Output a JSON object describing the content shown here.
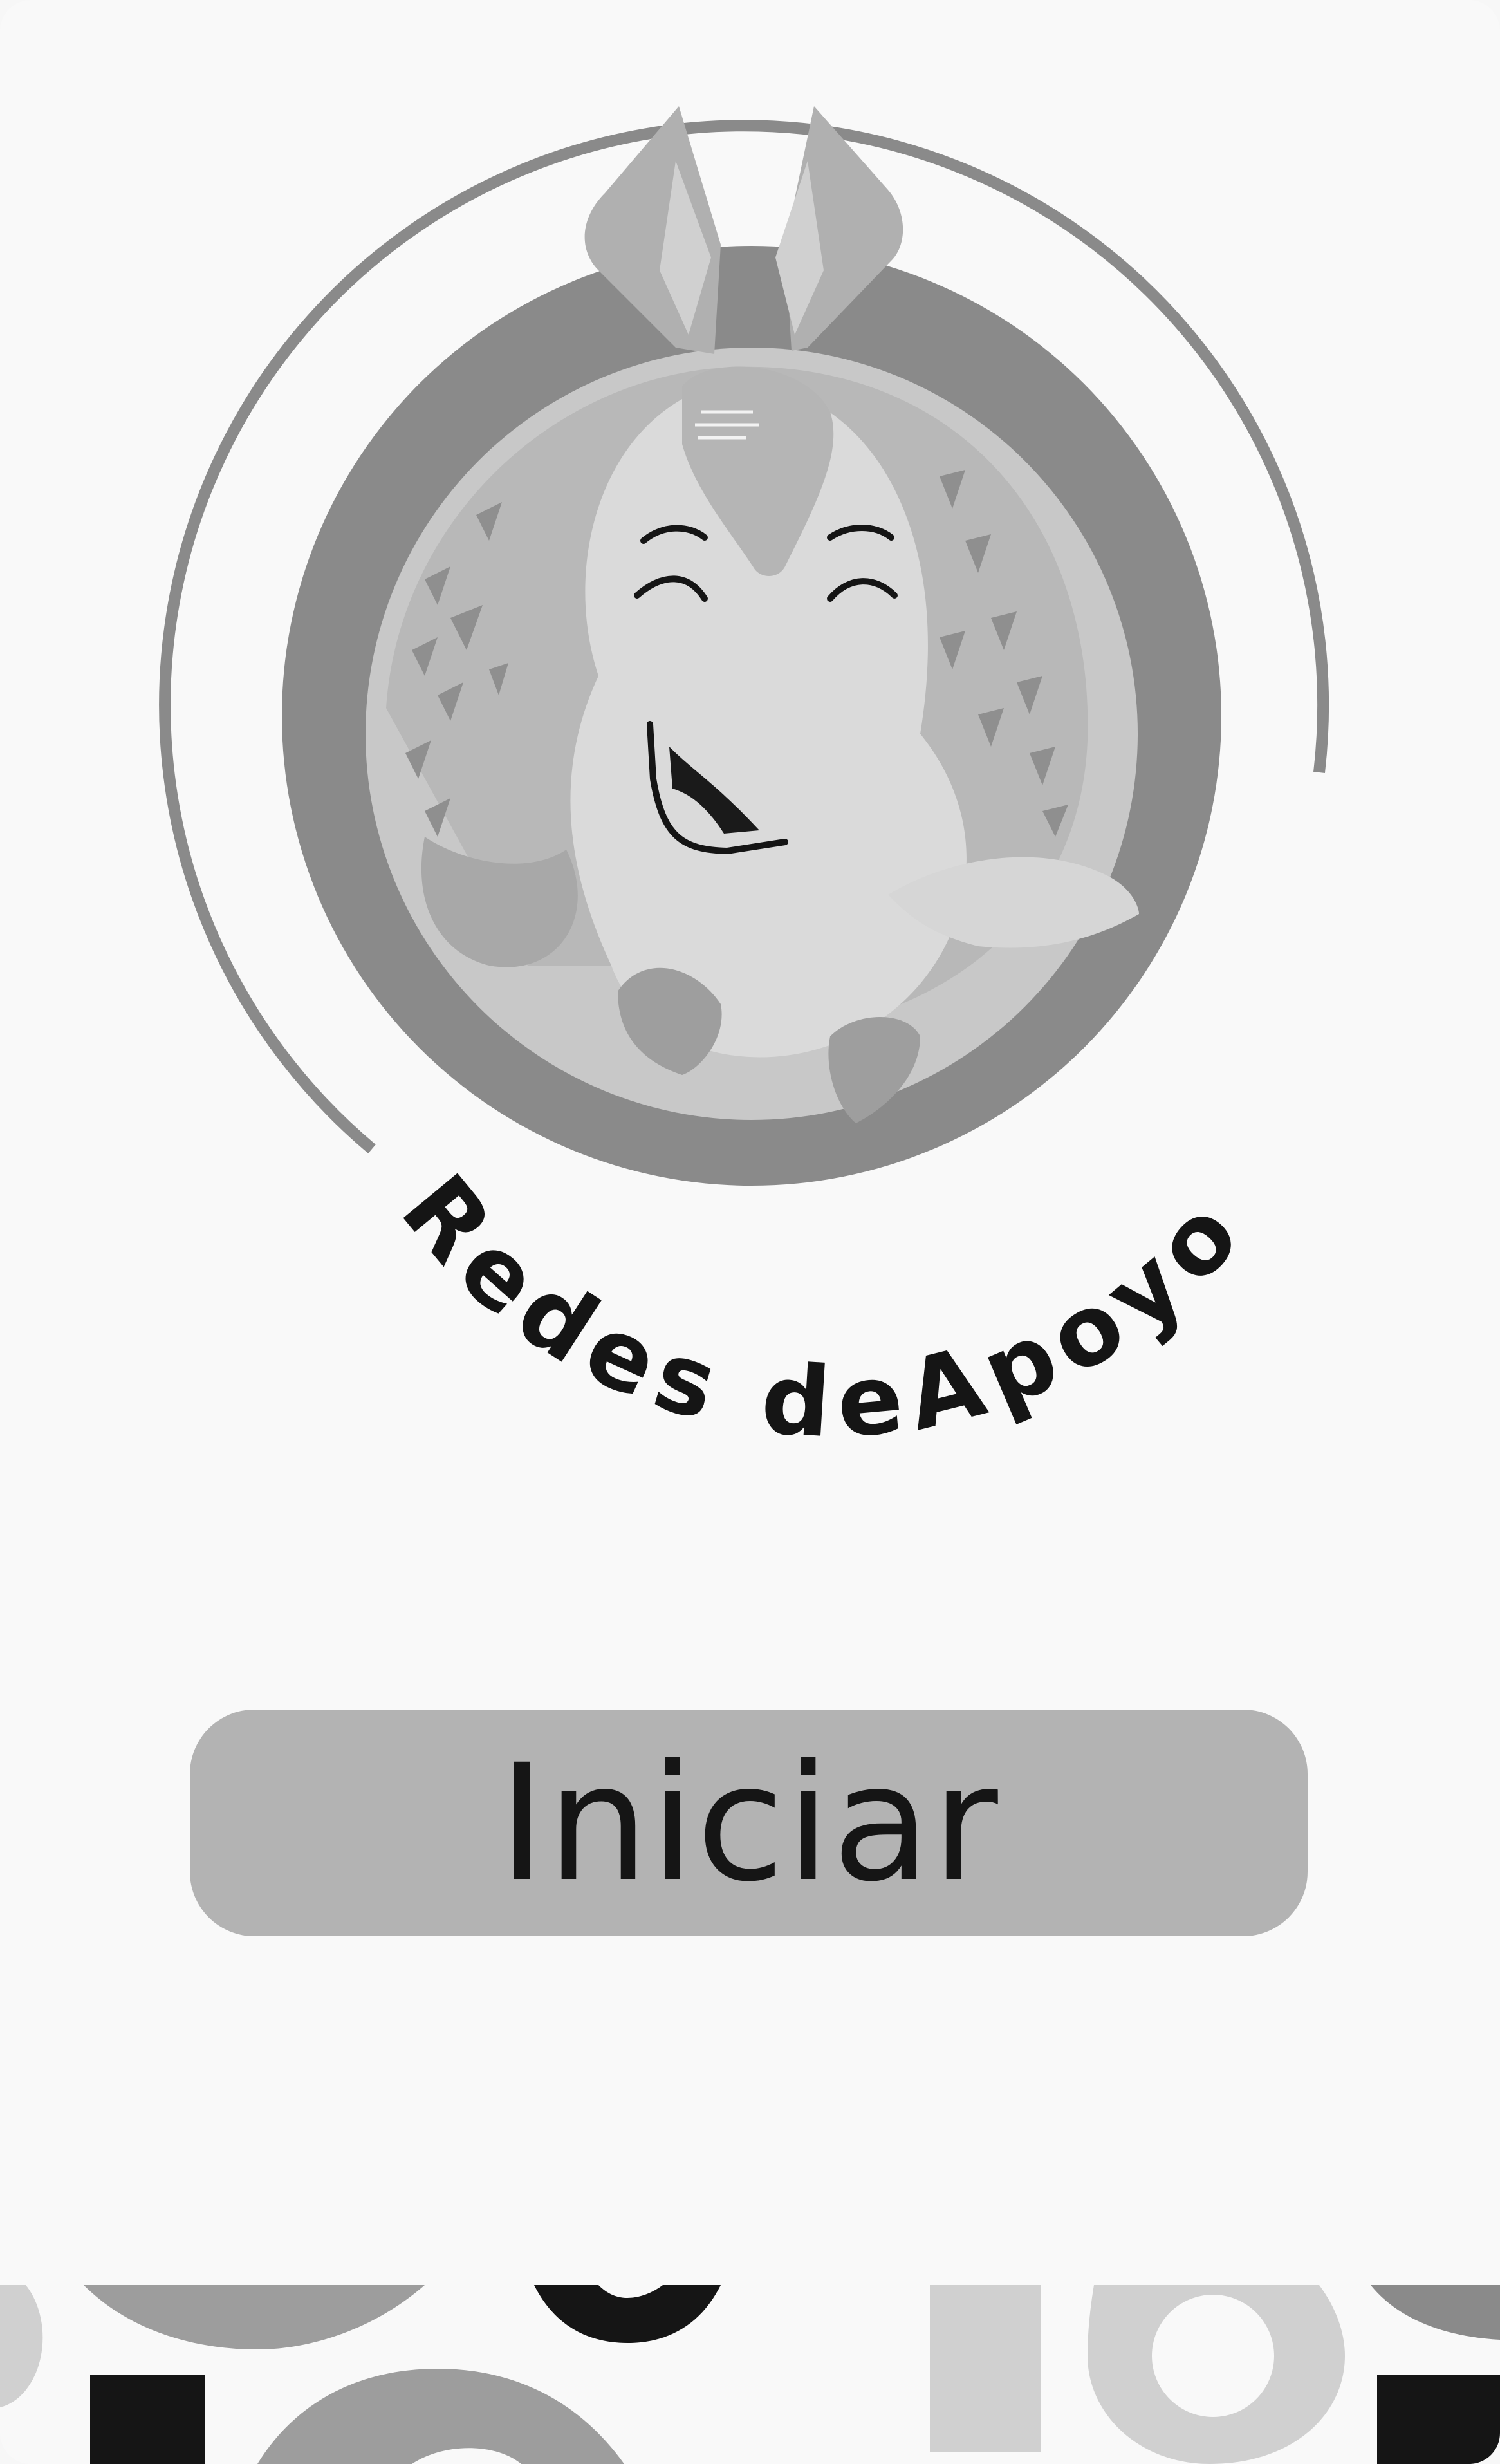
{
  "logo": {
    "text": "Redes deApoyo",
    "icon": "armadillo-mascot"
  },
  "start_button": {
    "label": "Iniciar"
  },
  "colors": {
    "background": "#f9f9f9",
    "button": "#b3b3b3",
    "ring": "#8a8a8a",
    "text": "#151515"
  }
}
